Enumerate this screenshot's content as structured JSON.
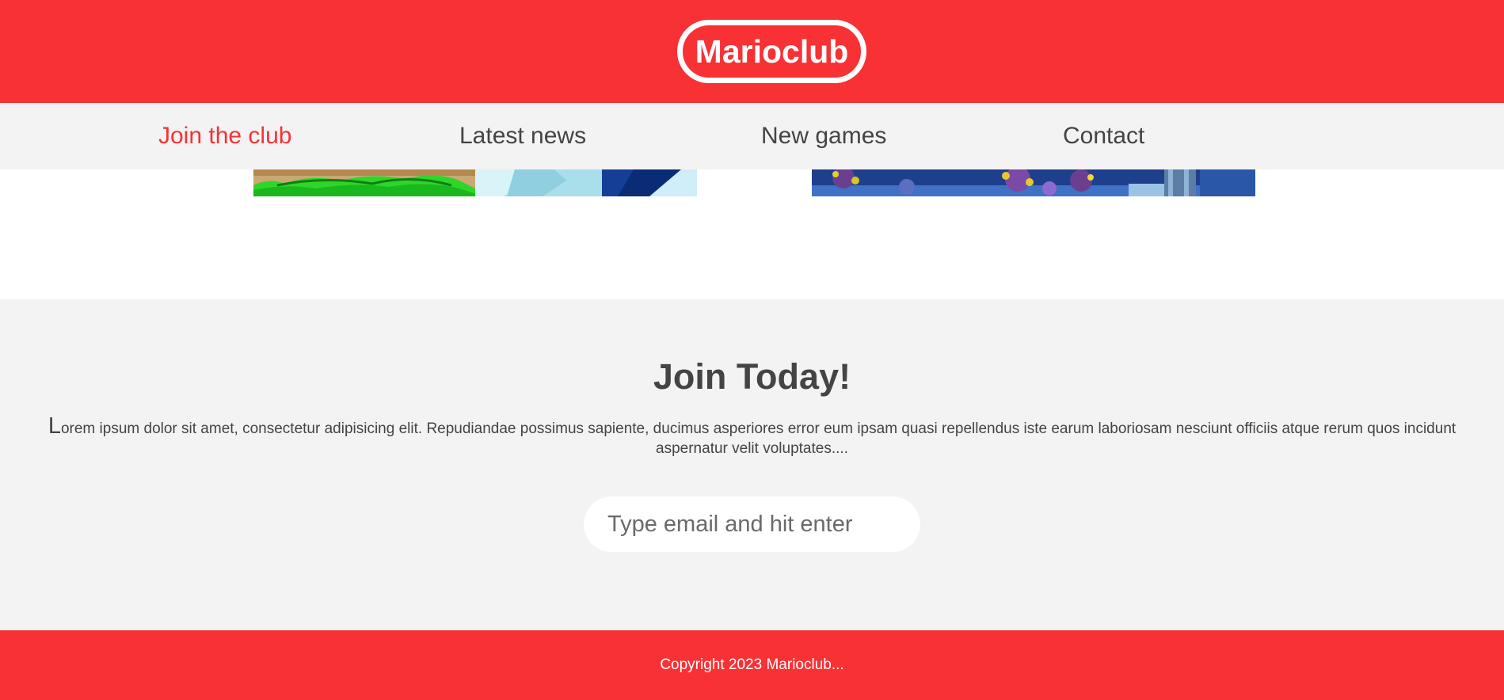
{
  "header": {
    "logo_text": "Marioclub"
  },
  "nav": {
    "items": [
      {
        "label": "Join the club",
        "active": true
      },
      {
        "label": "Latest news",
        "active": false
      },
      {
        "label": "New games",
        "active": false
      },
      {
        "label": "Contact",
        "active": false
      }
    ]
  },
  "join": {
    "title": "Join Today!",
    "text_first_letter": "L",
    "text_rest": "orem ipsum dolor sit amet, consectetur adipisicing elit. Repudiandae possimus sapiente, ducimus asperiores error eum ipsam quasi repellendus iste earum laboriosam nesciunt officiis atque rerum quos incidunt aspernatur velit voluptates....",
    "email_placeholder": "Type email and hit enter"
  },
  "footer": {
    "copyright": "Copyright 2023 Marioclub..."
  },
  "colors": {
    "brand_red": "#f73134",
    "panel_gray": "#f3f3f3",
    "text_dark": "#444444"
  }
}
